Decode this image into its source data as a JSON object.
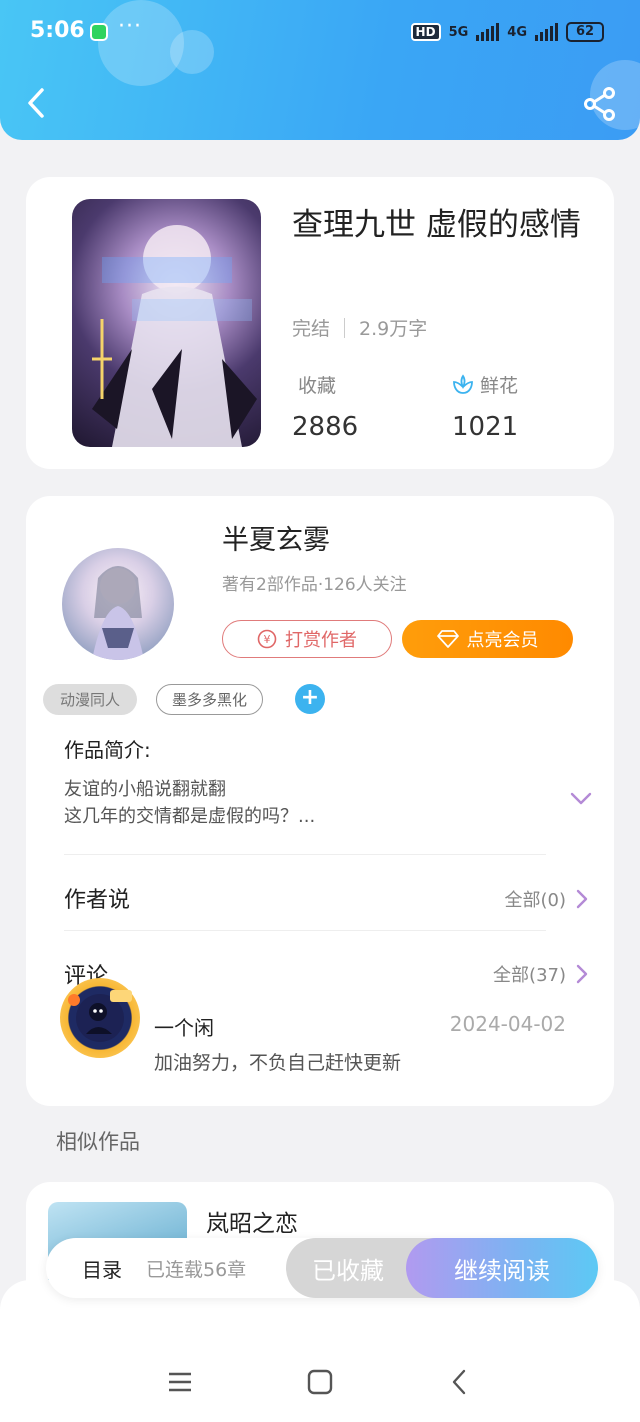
{
  "status_bar": {
    "time": "5:06",
    "more": "···",
    "hd": "HD",
    "net1": "5G",
    "net2": "4G",
    "battery": "62"
  },
  "book": {
    "title": "查理九世 虚假的感情",
    "status": "完结",
    "word_count": "2.9万字",
    "favorites_label": "收藏",
    "favorites_value": "2886",
    "flowers_label": "鲜花",
    "flowers_value": "1021"
  },
  "author": {
    "name": "半夏玄雾",
    "info": "著有2部作品·126人关注",
    "tip_button": "打赏作者",
    "vip_button": "点亮会员",
    "tags": [
      "动漫同人",
      "墨多多黑化"
    ],
    "add_tag": "+"
  },
  "intro": {
    "label": "作品简介:",
    "line1": "友谊的小船说翻就翻",
    "line2": "这几年的交情都是虚假的吗？..."
  },
  "author_says": {
    "label": "作者说",
    "link": "全部(0)"
  },
  "comments": {
    "label": "评论",
    "link": "全部(37)",
    "items": [
      {
        "user": "一个闲",
        "date": "2024-04-02",
        "text": "加油努力，不负自己赶快更新"
      }
    ]
  },
  "similar": {
    "section_title": "相似作品",
    "items": [
      {
        "title": "岚昭之恋"
      }
    ]
  },
  "action_bar": {
    "toc": "目录",
    "serial_info": "已连载56章",
    "favorited": "已收藏",
    "continue_reading": "继续阅读"
  },
  "colors": {
    "header_gradient": [
      "#49c6f5",
      "#3b9cf4"
    ],
    "vip_orange": "#ff8a00",
    "tip_red": "#e06767",
    "accent_blue": "#3cb3ef",
    "read_gradient": [
      "#b19af0",
      "#5cc9f4"
    ]
  }
}
